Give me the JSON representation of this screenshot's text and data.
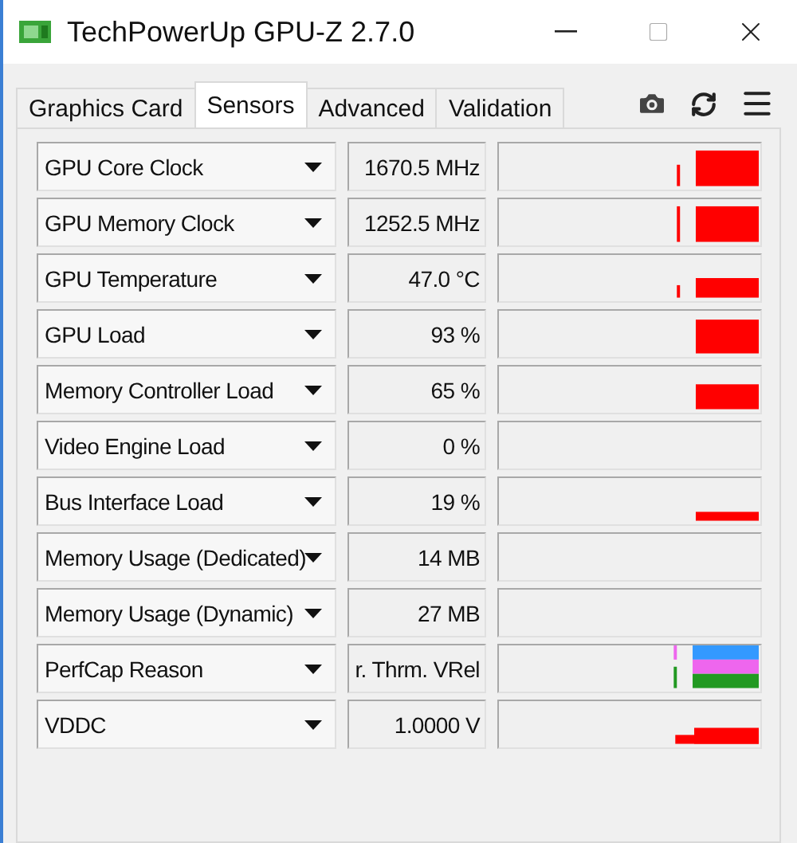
{
  "window": {
    "title": "TechPowerUp GPU-Z 2.7.0"
  },
  "tabs": [
    {
      "label": "Graphics Card",
      "selected": false
    },
    {
      "label": "Sensors",
      "selected": true
    },
    {
      "label": "Advanced",
      "selected": false
    },
    {
      "label": "Validation",
      "selected": false
    }
  ],
  "sensors": [
    {
      "name": "GPU Core Clock",
      "value": "1670.5 MHz"
    },
    {
      "name": "GPU Memory Clock",
      "value": "1252.5 MHz"
    },
    {
      "name": "GPU Temperature",
      "value": "47.0 °C"
    },
    {
      "name": "GPU Load",
      "value": "93 %"
    },
    {
      "name": "Memory Controller Load",
      "value": "65 %"
    },
    {
      "name": "Video Engine Load",
      "value": "0 %"
    },
    {
      "name": "Bus Interface Load",
      "value": "19 %"
    },
    {
      "name": "Memory Usage (Dedicated)",
      "value": "14 MB"
    },
    {
      "name": "Memory Usage (Dynamic)",
      "value": "27 MB"
    },
    {
      "name": "PerfCap Reason",
      "value": "r. Thrm. VRel"
    },
    {
      "name": "VDDC",
      "value": "1.0000 V"
    }
  ]
}
